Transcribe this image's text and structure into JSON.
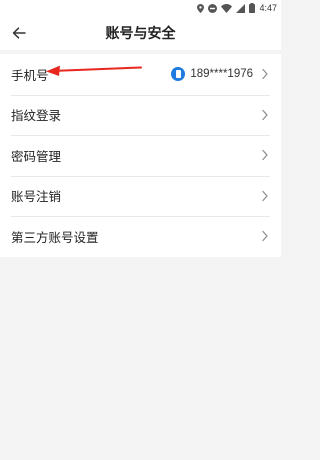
{
  "status_bar": {
    "time": "4:47",
    "icons": [
      "location-icon",
      "do-not-disturb-icon",
      "wifi-icon",
      "signal-icon",
      "battery-icon"
    ]
  },
  "header": {
    "title": "账号与安全",
    "back_icon": "back-arrow-icon"
  },
  "settings": {
    "items": [
      {
        "label": "手机号",
        "value": "189****1976",
        "icon": "phone-badge-icon"
      },
      {
        "label": "指纹登录"
      },
      {
        "label": "密码管理"
      },
      {
        "label": "账号注销"
      },
      {
        "label": "第三方账号设置"
      }
    ]
  },
  "colors": {
    "accent": "#1f7be0",
    "annotation": "#e8271f",
    "background": "#f4f4f4"
  }
}
